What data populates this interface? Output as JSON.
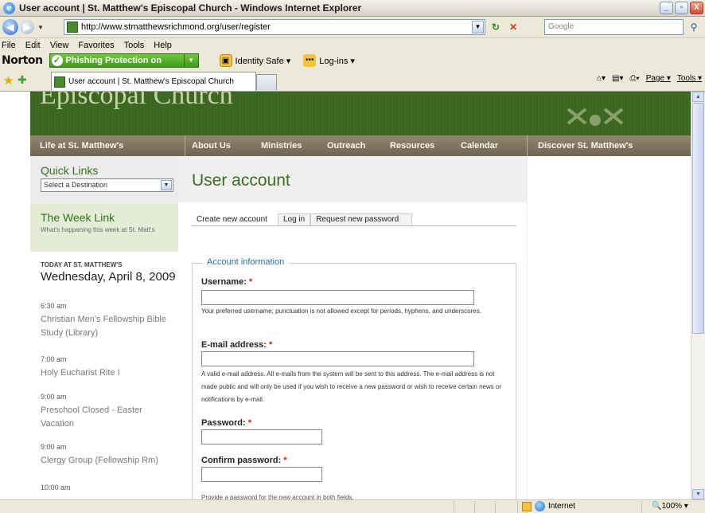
{
  "window": {
    "title": "User account | St. Matthew's Episcopal Church - Windows Internet Explorer",
    "logo_text": "e",
    "buttons": [
      "_",
      "▫",
      "X"
    ]
  },
  "address_bar": {
    "url": "http://www.stmatthewsrichmond.org/user/register",
    "search_placeholder": "Google"
  },
  "menu": [
    "File",
    "Edit",
    "View",
    "Favorites",
    "Tools",
    "Help"
  ],
  "norton": {
    "logo": "Norton",
    "phishing": "Phishing Protection on",
    "identity_safe": "Identity Safe ▾",
    "logins": "Log-ins ▾",
    "logins_icon": "•••"
  },
  "tab": {
    "label": "User account | St. Matthew's Episcopal Church"
  },
  "command_bar": {
    "page": "Page ▾",
    "tools": "Tools ▾"
  },
  "site": {
    "header_title": "Episcopal Church",
    "nav": [
      "Life at St. Matthew's",
      "About Us",
      "Ministries",
      "Outreach",
      "Resources",
      "Calendar",
      "Discover St. Matthew's"
    ]
  },
  "sidebar": {
    "quick_links_title": "Quick Links",
    "quick_links_select": "Select a Destination",
    "week_link_title": "The Week Link",
    "week_link_sub": "What's happening this week at St. Matt's",
    "today_label": "TODAY AT ST. MATTHEW'S",
    "today_date": "Wednesday, April 8, 2009",
    "events": [
      {
        "time": "6:30 am",
        "title": "Christian Men's Fellowship Bible Study (Library)"
      },
      {
        "time": "7:00 am",
        "title": "Holy Eucharist Rite I"
      },
      {
        "time": "9:00 am",
        "title": "Preschool Closed - Easter Vacation"
      },
      {
        "time": "9:00 am",
        "title": "Clergy Group (Fellowship Rm)"
      },
      {
        "time": "10:00 am",
        "title": ""
      }
    ]
  },
  "main": {
    "title": "User account",
    "tabs": [
      "Create new account",
      "Log in",
      "Request new password"
    ],
    "legend": "Account information",
    "required_mark": "*",
    "username_label": "Username:",
    "username_desc": "Your preferred username; punctuation is not allowed except for periods, hyphens, and underscores.",
    "email_label": "E-mail address:",
    "email_desc": "A valid e-mail address. All e-mails from the system will be sent to this address. The e-mail address is not made public and will only be used if you wish to receive a new password or wish to receive certain news or notifications by e-mail.",
    "password_label": "Password:",
    "confirm_label": "Confirm password:",
    "cut_desc": "Provide a password for the new account in both fields."
  },
  "statusbar": {
    "zone": "Internet",
    "zoom": "100%"
  }
}
